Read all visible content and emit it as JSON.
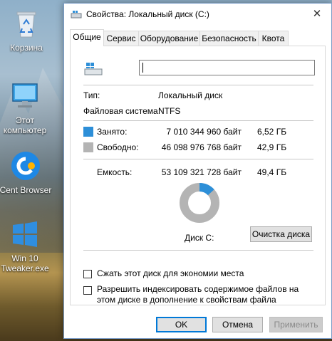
{
  "desktop": {
    "icons": [
      {
        "label": "Корзина"
      },
      {
        "label": "Этот компьютер"
      },
      {
        "label": "Cent Browser"
      },
      {
        "label": "Win 10 Tweaker.exe"
      }
    ]
  },
  "window": {
    "title": "Свойства: Локальный диск (C:)",
    "close_glyph": "✕",
    "tabs": [
      "Общие",
      "Сервис",
      "Оборудование",
      "Безопасность",
      "Квота"
    ],
    "active_tab": "Общие",
    "drive_name_value": "",
    "type_label": "Тип:",
    "type_value": "Локальный диск",
    "fs_label": "Файловая система:",
    "fs_value": "NTFS",
    "used_label": "Занято:",
    "used_bytes": "7 010 344 960 байт",
    "used_gb": "6,52 ГБ",
    "free_label": "Свободно:",
    "free_bytes": "46 098 976 768 байт",
    "free_gb": "42,9 ГБ",
    "capacity_label": "Емкость:",
    "capacity_bytes": "53 109 321 728 байт",
    "capacity_gb": "49,4 ГБ",
    "disk_label": "Диск C:",
    "cleanup_button": "Очистка диска",
    "compress_label": "Сжать этот диск для экономии места",
    "compress_checked": false,
    "index_label": "Разрешить индексировать содержимое файлов на этом диске в дополнение к свойствам файла",
    "index_checked": false,
    "ok_button": "OK",
    "cancel_button": "Отмена",
    "apply_button": "Применить",
    "used_fraction": 0.132,
    "colors": {
      "used": "#2d8fd8",
      "free": "#b4b4b4",
      "accent": "#0078d7"
    }
  }
}
